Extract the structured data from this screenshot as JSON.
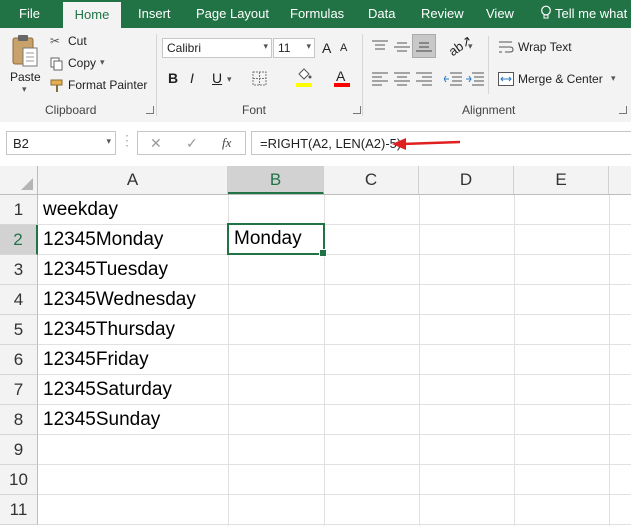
{
  "tabs": {
    "file": "File",
    "home": "Home",
    "insert": "Insert",
    "page_layout": "Page Layout",
    "formulas": "Formulas",
    "data": "Data",
    "review": "Review",
    "view": "View",
    "tell_me": "Tell me what y"
  },
  "clipboard": {
    "paste": "Paste",
    "cut": "Cut",
    "copy": "Copy",
    "format_painter": "Format Painter",
    "group": "Clipboard"
  },
  "font": {
    "name": "Calibri",
    "size": "11",
    "bold": "B",
    "italic": "I",
    "underline": "U",
    "font_color_letter": "A",
    "grow": "A",
    "shrink": "A",
    "group": "Font",
    "highlight_color": "#ffff00",
    "font_color": "#ff0000"
  },
  "alignment": {
    "wrap_text": "Wrap Text",
    "merge_center": "Merge & Center",
    "group": "Alignment"
  },
  "formula_bar": {
    "name_box": "B2",
    "cancel": "✕",
    "enter": "✓",
    "fx": "fx",
    "formula": "=RIGHT(A2, LEN(A2)-5)"
  },
  "columns": [
    "A",
    "B",
    "C",
    "D",
    "E"
  ],
  "rows": [
    "1",
    "2",
    "3",
    "4",
    "5",
    "6",
    "7",
    "8",
    "9",
    "10",
    "11"
  ],
  "cells": {
    "A1": "weekday",
    "A2": "12345Monday",
    "A3": "12345Tuesday",
    "A4": "12345Wednesday",
    "A5": "12345Thursday",
    "A6": "12345Friday",
    "A7": "12345Saturday",
    "A8": "12345Sunday",
    "B2": "Monday"
  },
  "colors": {
    "excel_green": "#217346",
    "annotation_arrow": "#e02020"
  }
}
